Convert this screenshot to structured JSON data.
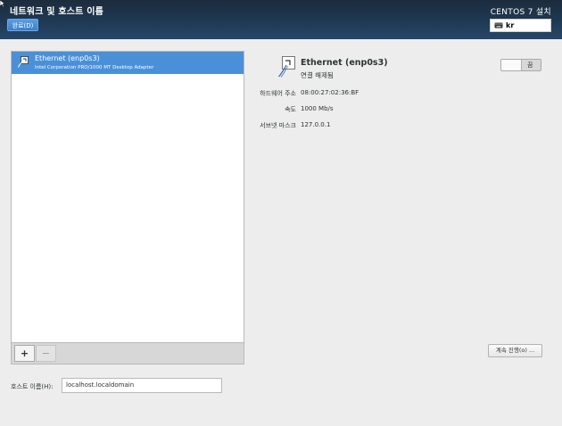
{
  "header": {
    "page_title": "네트워크 및 호스트 이름",
    "done_label": "완료(D)",
    "install_title": "CENTOS 7 설치",
    "keyboard_layout": "kr"
  },
  "devices": {
    "items": [
      {
        "name": "Ethernet (enp0s3)",
        "description": "Intel Corporation PRO/1000 MT Desktop Adapter",
        "selected": true
      }
    ],
    "add_label": "+",
    "remove_label": "−"
  },
  "detail": {
    "name": "Ethernet (enp0s3)",
    "status": "연결 해제됨",
    "toggle_label": "끔",
    "toggle_on": false,
    "properties": [
      {
        "label": "하드웨어 주소",
        "value": "08:00:27:02:36:BF"
      },
      {
        "label": "속도",
        "value": "1000 Mb/s"
      },
      {
        "label": "서브넷 마스크",
        "value": "127.0.0.1"
      }
    ],
    "configure_label": "계속 진행(o) ..."
  },
  "hostname": {
    "label": "호스트 이름(H):",
    "value": "localhost.localdomain"
  },
  "colors": {
    "header_dark": "#1c2c3d",
    "accent_blue": "#4a90d9",
    "background": "#ededed"
  },
  "icons": {
    "network": "ethernet-cable-icon",
    "keyboard": "keyboard-icon"
  }
}
